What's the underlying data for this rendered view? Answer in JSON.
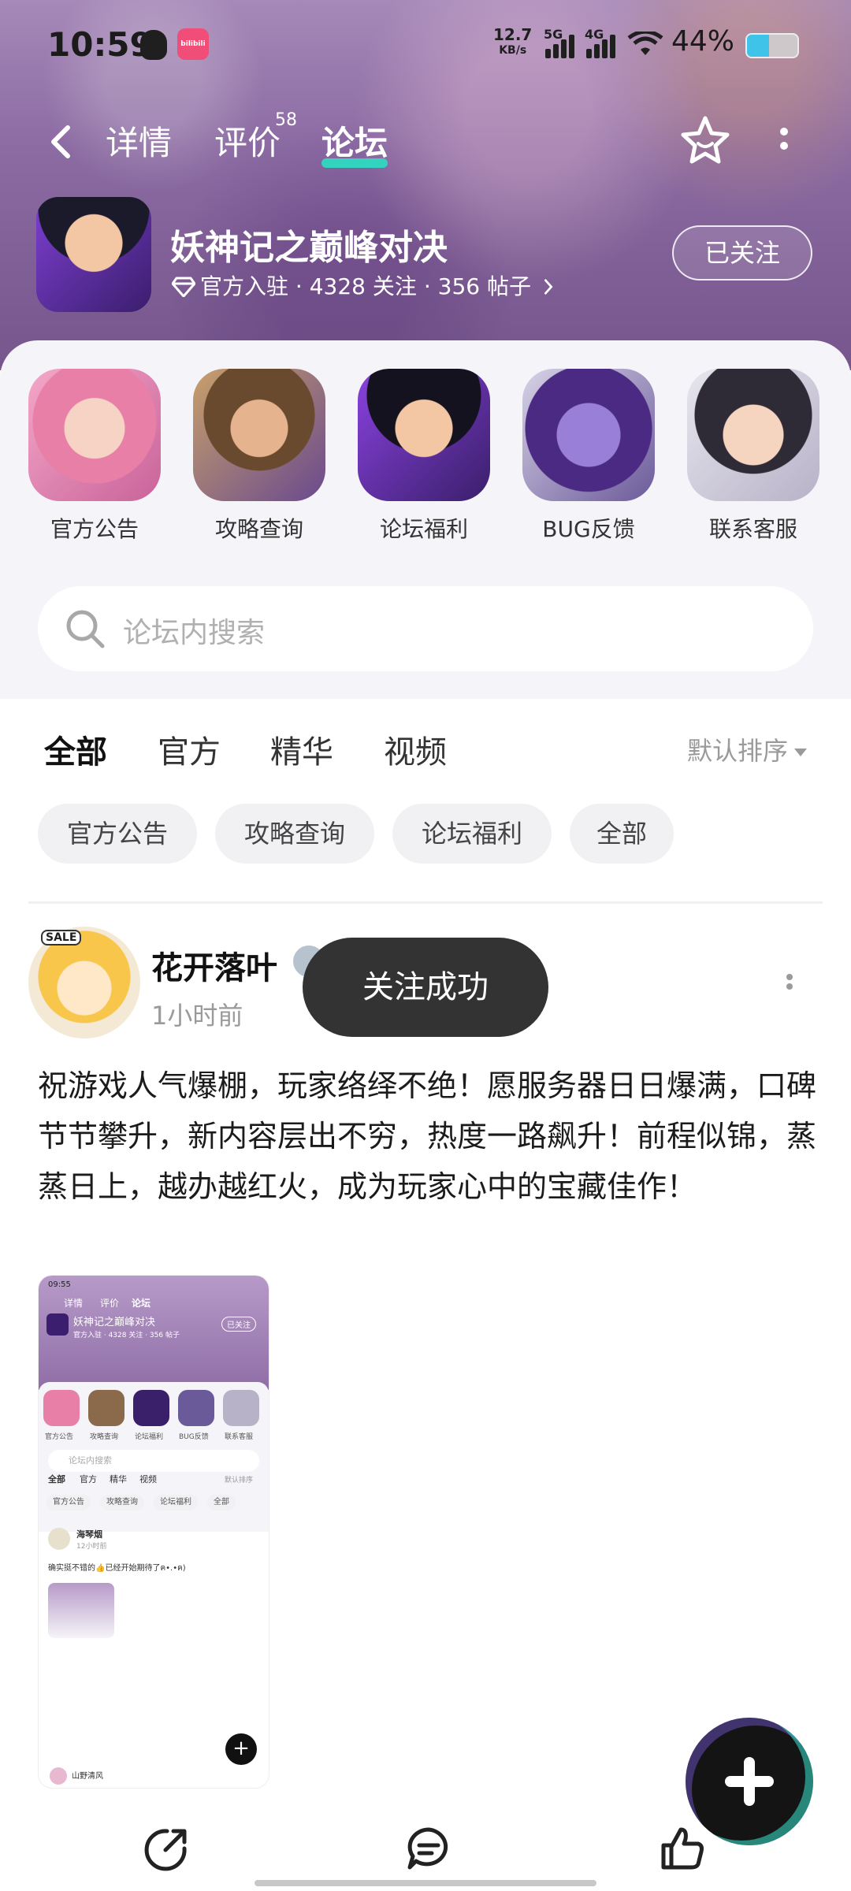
{
  "status_bar": {
    "time": "10:59",
    "app_badge": "bilibili",
    "net_speed_value": "12.7",
    "net_speed_unit": "KB/s",
    "signal_1_label": "5G",
    "signal_2_label": "4G",
    "battery_percent": "44%",
    "battery_level": 0.44,
    "icons": [
      "qq-icon",
      "bilibili-icon",
      "wifi-icon",
      "battery-icon"
    ]
  },
  "nav": {
    "tabs": [
      {
        "label": "详情"
      },
      {
        "label": "评价",
        "badge": "58"
      },
      {
        "label": "论坛",
        "active": true
      }
    ],
    "accent": "#34d3bf"
  },
  "game": {
    "title": "妖神记之巅峰对决",
    "official": "官方入驻",
    "follows": "4328 关注",
    "posts": "356 帖子",
    "follow_state": "已关注"
  },
  "quick_actions": [
    {
      "label": "官方公告"
    },
    {
      "label": "攻略查询"
    },
    {
      "label": "论坛福利"
    },
    {
      "label": "BUG反馈"
    },
    {
      "label": "联系客服"
    }
  ],
  "search": {
    "placeholder": "论坛内搜索"
  },
  "filter_tabs": {
    "items": [
      "全部",
      "官方",
      "精华",
      "视频"
    ],
    "active": "全部",
    "sort_label": "默认排序"
  },
  "chips": [
    "官方公告",
    "攻略查询",
    "论坛福利",
    "全部"
  ],
  "post": {
    "author": "花开落叶",
    "avatar_badge": "SALE",
    "time_ago": "1小时前",
    "body": "祝游戏人气爆棚，玩家络绎不绝！愿服务器日日爆满，口碑节节攀升，新内容层出不穷，热度一路飙升！前程似锦，蒸蒸日上，越办越红火，成为玩家心中的宝藏佳作！",
    "thumbnail": {
      "time": "09:55",
      "tabs": [
        "详情",
        "评价",
        "论坛"
      ],
      "title": "妖神记之巅峰对决",
      "follow_state": "已关注",
      "meta": "官方入驻 · 4328 关注 · 356 帖子",
      "quick_labels": [
        "官方公告",
        "攻略查询",
        "论坛福利",
        "BUG反馈",
        "联系客服"
      ],
      "search_placeholder": "论坛内搜索",
      "filter_tabs": [
        "全部",
        "官方",
        "精华",
        "视频"
      ],
      "sort_label": "默认排序",
      "chips": [
        "官方公告",
        "攻略查询",
        "论坛福利",
        "全部"
      ],
      "post_author": "海琴烟",
      "post_time": "12小时前",
      "post_text": "确实挺不错的👍已经开始期待了ฅ•.•ฅ)",
      "next_author": "山野清风"
    }
  },
  "toast": "关注成功",
  "fab": {
    "icon": "plus-icon"
  },
  "bottom_actions": [
    "share-icon",
    "comment-icon",
    "like-icon"
  ]
}
